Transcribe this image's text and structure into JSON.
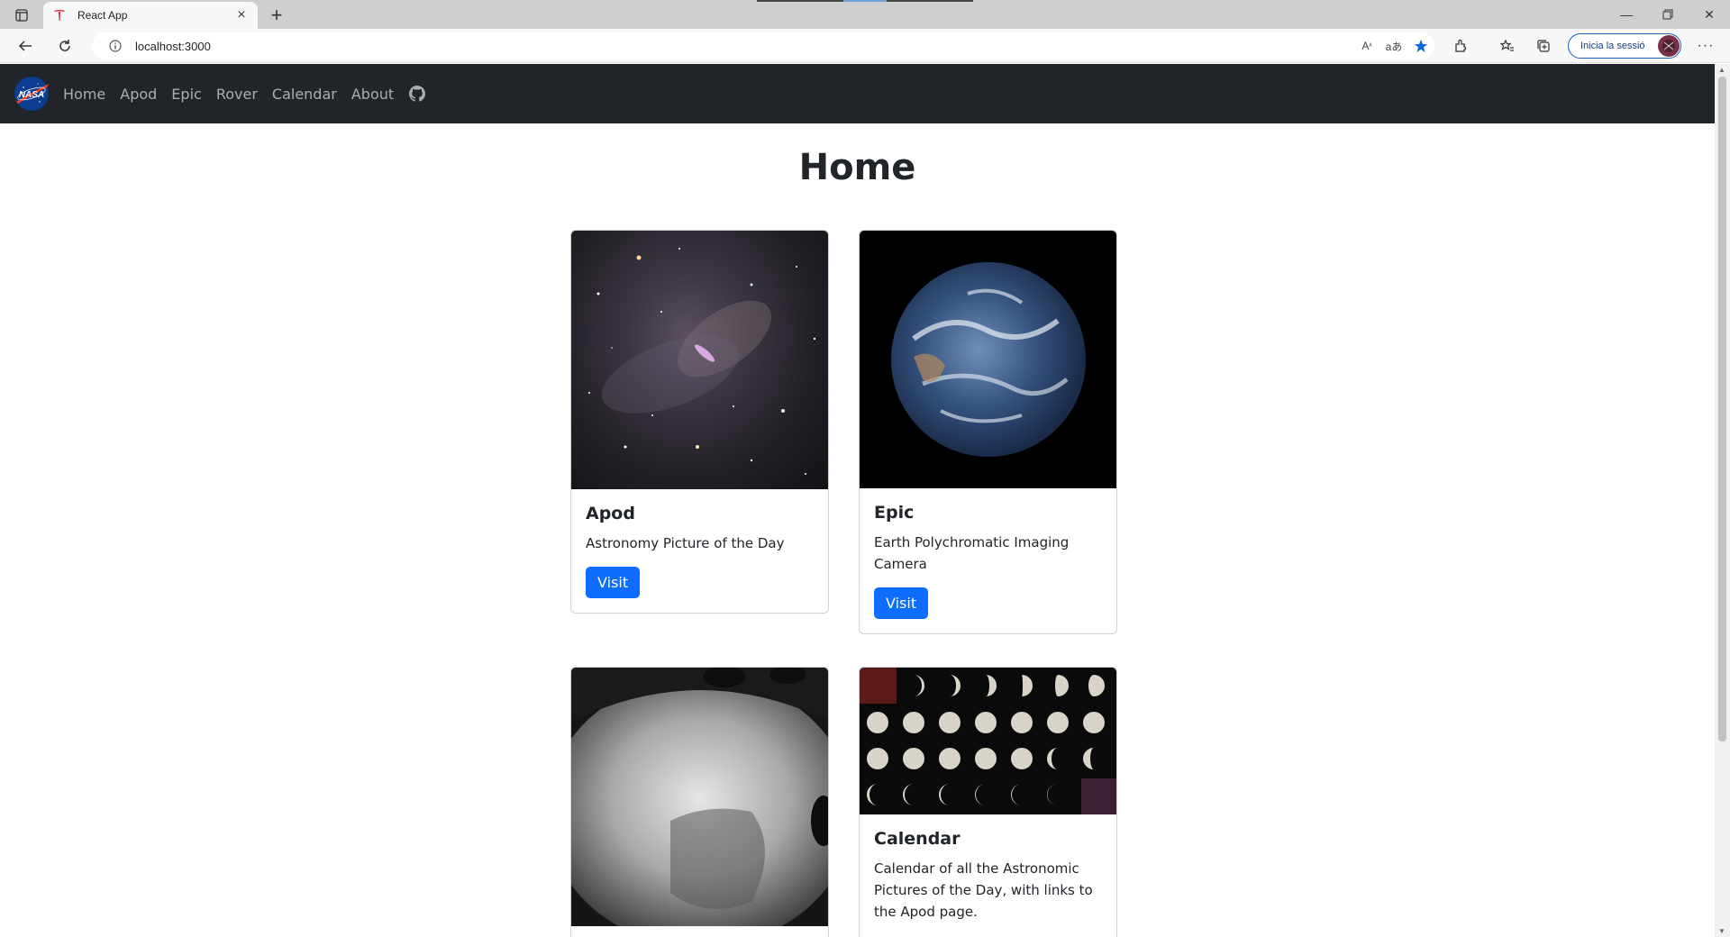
{
  "browser": {
    "tab_title": "React App",
    "url": "localhost:3000",
    "signin_label": "Inicia la sessió",
    "read_aloud_label": "Aᴬ",
    "translate_label": "à́"
  },
  "navbar": {
    "brand": "NASA",
    "links": [
      "Home",
      "Apod",
      "Epic",
      "Rover",
      "Calendar",
      "About"
    ]
  },
  "page": {
    "title": "Home"
  },
  "cards": [
    {
      "title": "Apod",
      "text": "Astronomy Picture of the Day",
      "button": "Visit"
    },
    {
      "title": "Epic",
      "text": "Earth Polychromatic Imaging Camera",
      "button": "Visit"
    },
    {
      "title": "",
      "text": "",
      "button": ""
    },
    {
      "title": "Calendar",
      "text": "Calendar of all the Astronomic Pictures of the Day, with links to the Apod page.",
      "button": ""
    }
  ],
  "colors": {
    "navbar_bg": "#212529",
    "primary": "#0d6efd",
    "favicon": "#e31937"
  }
}
